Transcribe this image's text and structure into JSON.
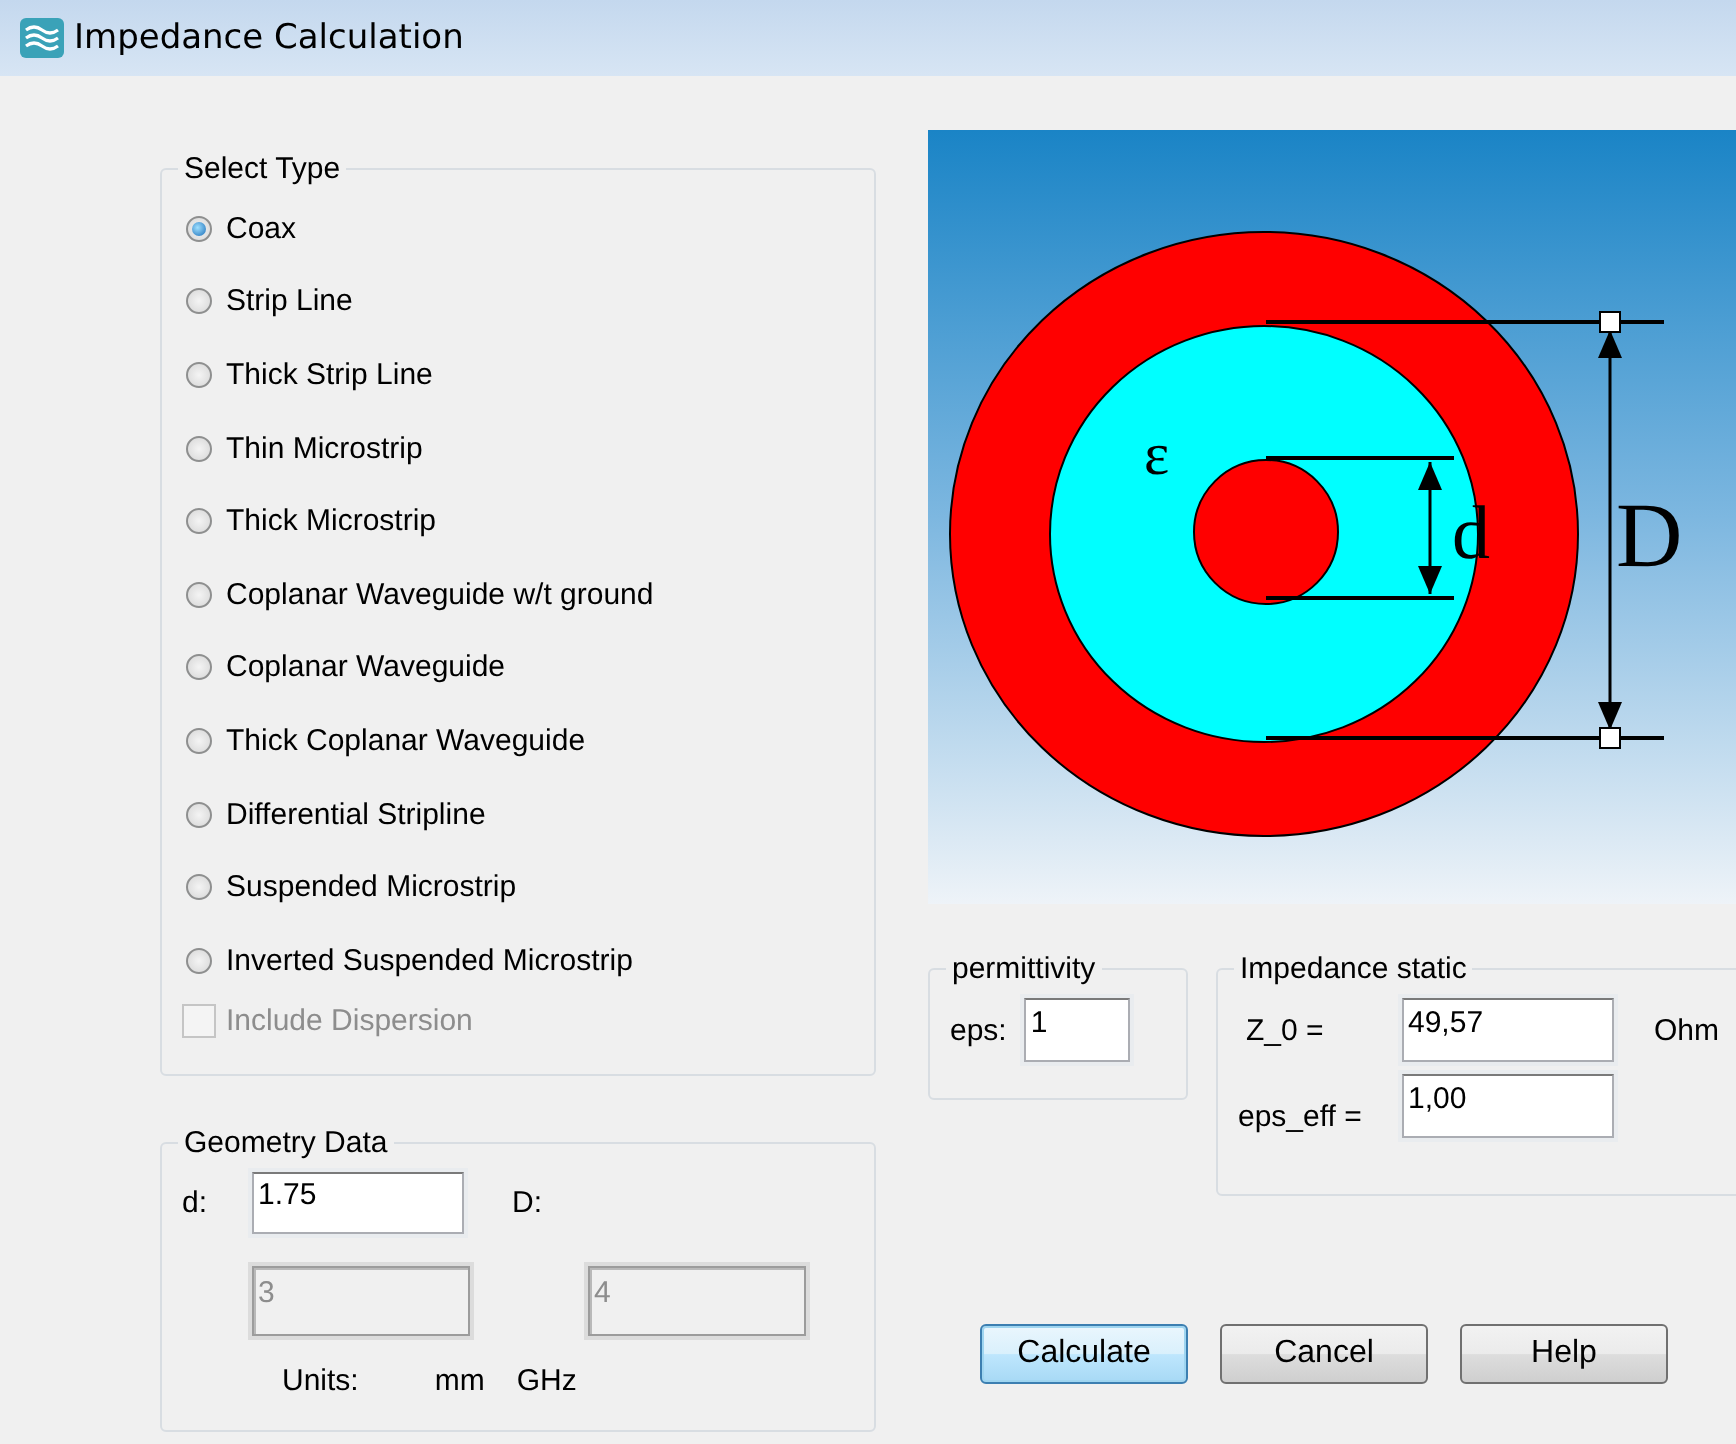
{
  "window": {
    "title": "Impedance Calculation"
  },
  "select_type": {
    "label": "Select Type",
    "options": [
      {
        "label": "Coax",
        "selected": true
      },
      {
        "label": "Strip Line",
        "selected": false
      },
      {
        "label": "Thick Strip Line",
        "selected": false
      },
      {
        "label": "Thin Microstrip",
        "selected": false
      },
      {
        "label": "Thick Microstrip",
        "selected": false
      },
      {
        "label": "Coplanar Waveguide w/t ground",
        "selected": false
      },
      {
        "label": "Coplanar Waveguide",
        "selected": false
      },
      {
        "label": "Thick Coplanar Waveguide",
        "selected": false
      },
      {
        "label": "Differential Stripline",
        "selected": false
      },
      {
        "label": "Suspended Microstrip",
        "selected": false
      },
      {
        "label": "Inverted Suspended Microstrip",
        "selected": false
      }
    ],
    "include_dispersion": {
      "label": "Include Dispersion",
      "checked": false,
      "disabled": true
    }
  },
  "geometry": {
    "label": "Geometry Data",
    "d_label": "d:",
    "d_value": "1.75",
    "D_label": "D:",
    "fields": [
      {
        "value": "3",
        "disabled": true
      },
      {
        "value": "4",
        "disabled": true
      }
    ],
    "units_label": "Units:",
    "unit_1": "mm",
    "unit_2": "GHz"
  },
  "diagram": {
    "epsilon_label": "ε",
    "d_label": "d",
    "D_label": "D"
  },
  "permittivity": {
    "label": "permittivity",
    "eps_label": "eps:",
    "eps_value": "1"
  },
  "impedance": {
    "label": "Impedance static",
    "z0_label": "Z_0 =",
    "z0_value": "49,57",
    "z0_unit": "Ohm",
    "eps_eff_label": "eps_eff =",
    "eps_eff_value": "1,00"
  },
  "buttons": [
    {
      "label": "Calculate",
      "default": true
    },
    {
      "label": "Cancel",
      "default": false
    },
    {
      "label": "Help",
      "default": false
    }
  ]
}
